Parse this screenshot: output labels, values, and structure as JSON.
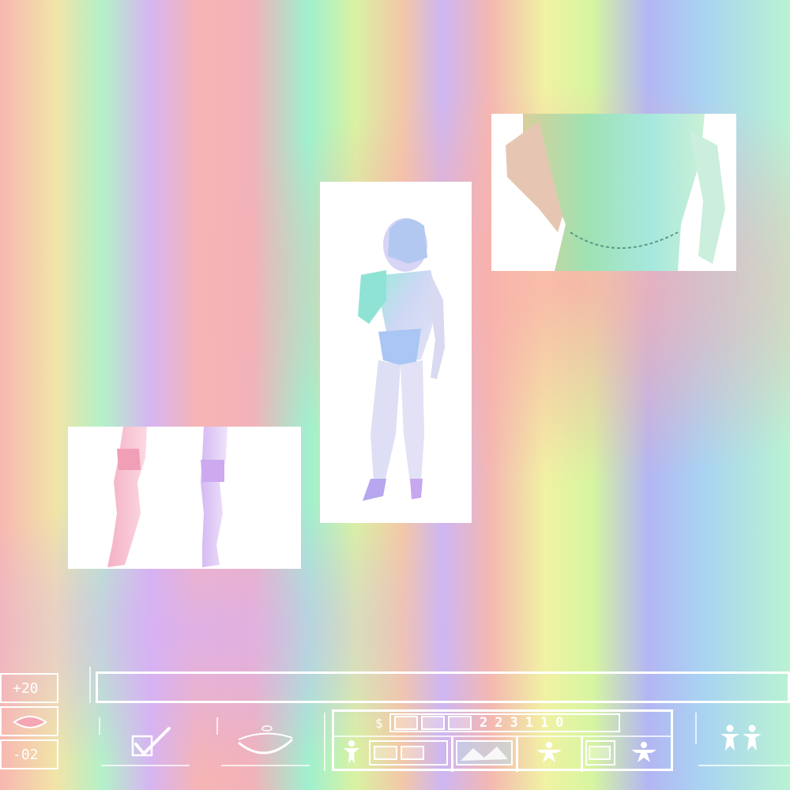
{
  "hud": {
    "value_top": "+20",
    "value_bottom": "-02",
    "money_symbol": "$",
    "money_digits": "223110",
    "icons": {
      "lips": "lips-icon",
      "confirm": "checkbox-check-icon",
      "mouth": "smile-icon",
      "figure": "figure-icon",
      "pose_left": "pose-icon",
      "pose_right": "pose-icon",
      "pair": "two-figures-icon"
    }
  }
}
